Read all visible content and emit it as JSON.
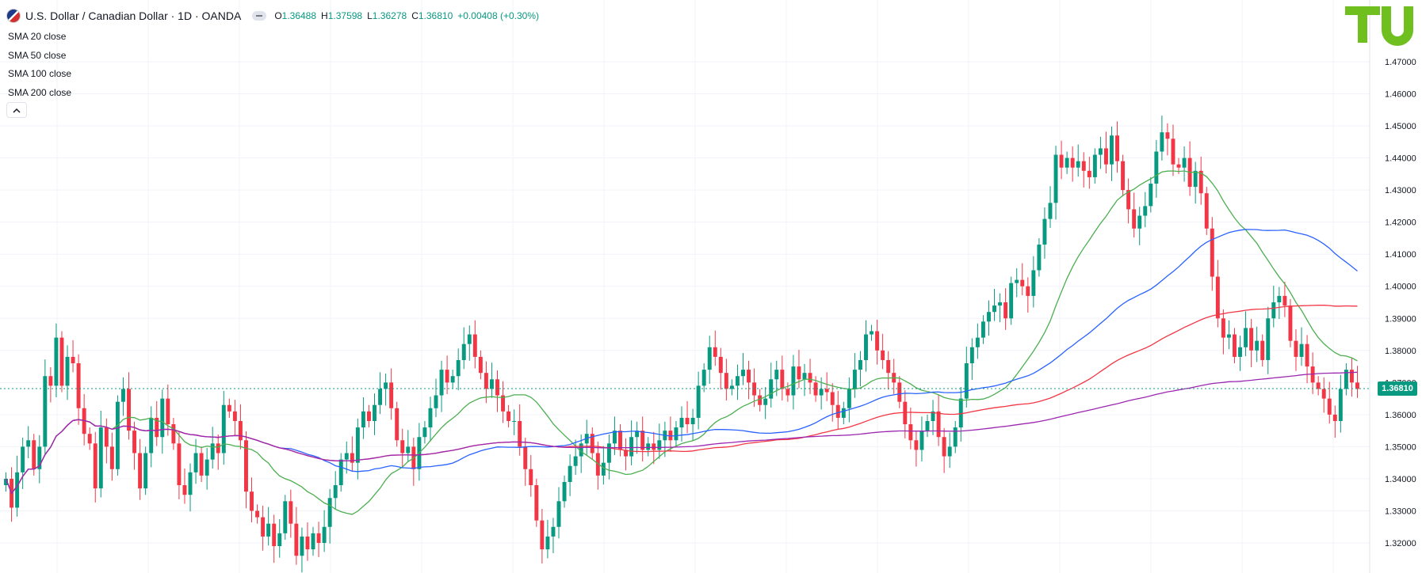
{
  "header": {
    "title": "U.S. Dollar / Canadian Dollar · 1D · OANDA",
    "ohlc": [
      {
        "label": "O",
        "value": "1.36488"
      },
      {
        "label": "H",
        "value": "1.37598"
      },
      {
        "label": "L",
        "value": "1.36278"
      },
      {
        "label": "C",
        "value": "1.36810"
      }
    ],
    "change": "+0.00408 (+0.30%)"
  },
  "indicators": [
    "SMA 20 close",
    "SMA 50 close",
    "SMA 100 close",
    "SMA 200 close"
  ],
  "legend_toggle_icon": "chevron-up-icon",
  "logo_text": "TU",
  "current_price_label": "1.36810",
  "colors": {
    "up": "#089981",
    "down": "#f23645",
    "sma20": "#4caf50",
    "sma50": "#2962ff",
    "sma100": "#f23645",
    "sma200": "#9c27b0",
    "logo": "#6fbf1f"
  },
  "chart_data": {
    "type": "candlestick",
    "title": "U.S. Dollar / Canadian Dollar",
    "y_ticks": [
      "1.47000",
      "1.46000",
      "1.45000",
      "1.44000",
      "1.43000",
      "1.42000",
      "1.41000",
      "1.40000",
      "1.39000",
      "1.38000",
      "1.37000",
      "1.36000",
      "1.35000",
      "1.34000",
      "1.33000",
      "1.32000"
    ],
    "ylim": [
      1.314,
      1.492
    ],
    "last_price": 1.3681,
    "close_path": [
      1.34,
      1.331,
      1.342,
      1.35,
      1.352,
      1.343,
      1.35,
      1.372,
      1.369,
      1.384,
      1.369,
      1.378,
      1.376,
      1.362,
      1.354,
      1.351,
      1.337,
      1.356,
      1.35,
      1.343,
      1.364,
      1.368,
      1.355,
      1.348,
      1.337,
      1.348,
      1.359,
      1.353,
      1.365,
      1.357,
      1.351,
      1.338,
      1.335,
      1.342,
      1.348,
      1.341,
      1.346,
      1.351,
      1.348,
      1.363,
      1.361,
      1.358,
      1.352,
      1.336,
      1.33,
      1.328,
      1.322,
      1.326,
      1.319,
      1.323,
      1.333,
      1.326,
      1.316,
      1.322,
      1.318,
      1.323,
      1.32,
      1.325,
      1.334,
      1.338,
      1.346,
      1.348,
      1.345,
      1.356,
      1.361,
      1.358,
      1.363,
      1.368,
      1.37,
      1.362,
      1.352,
      1.348,
      1.35,
      1.343,
      1.353,
      1.356,
      1.362,
      1.366,
      1.374,
      1.37,
      1.372,
      1.377,
      1.382,
      1.385,
      1.378,
      1.373,
      1.368,
      1.371,
      1.366,
      1.361,
      1.358,
      1.358,
      1.35,
      1.343,
      1.338,
      1.327,
      1.318,
      1.322,
      1.325,
      1.333,
      1.339,
      1.344,
      1.347,
      1.351,
      1.354,
      1.348,
      1.341,
      1.345,
      1.351,
      1.355,
      1.349,
      1.347,
      1.353,
      1.355,
      1.349,
      1.351,
      1.349,
      1.352,
      1.355,
      1.352,
      1.356,
      1.359,
      1.357,
      1.359,
      1.369,
      1.374,
      1.381,
      1.378,
      1.373,
      1.368,
      1.369,
      1.372,
      1.374,
      1.37,
      1.366,
      1.363,
      1.365,
      1.371,
      1.374,
      1.368,
      1.366,
      1.375,
      1.371,
      1.373,
      1.37,
      1.366,
      1.368,
      1.367,
      1.363,
      1.359,
      1.362,
      1.368,
      1.374,
      1.377,
      1.385,
      1.386,
      1.38,
      1.377,
      1.373,
      1.37,
      1.364,
      1.357,
      1.352,
      1.349,
      1.355,
      1.358,
      1.361,
      1.353,
      1.347,
      1.35,
      1.356,
      1.365,
      1.376,
      1.381,
      1.384,
      1.389,
      1.392,
      1.394,
      1.395,
      1.39,
      1.401,
      1.402,
      1.4,
      1.397,
      1.405,
      1.413,
      1.421,
      1.426,
      1.441,
      1.437,
      1.44,
      1.437,
      1.439,
      1.436,
      1.434,
      1.441,
      1.443,
      1.438,
      1.447,
      1.439,
      1.43,
      1.424,
      1.418,
      1.422,
      1.425,
      1.432,
      1.442,
      1.448,
      1.446,
      1.438,
      1.437,
      1.44,
      1.431,
      1.436,
      1.429,
      1.418,
      1.403,
      1.39,
      1.384,
      1.385,
      1.378,
      1.381,
      1.387,
      1.38,
      1.383,
      1.377,
      1.39,
      1.395,
      1.397,
      1.394,
      1.383,
      1.378,
      1.382,
      1.375,
      1.37,
      1.368,
      1.365,
      1.36,
      1.358,
      1.368,
      1.374,
      1.37,
      1.368
    ]
  }
}
